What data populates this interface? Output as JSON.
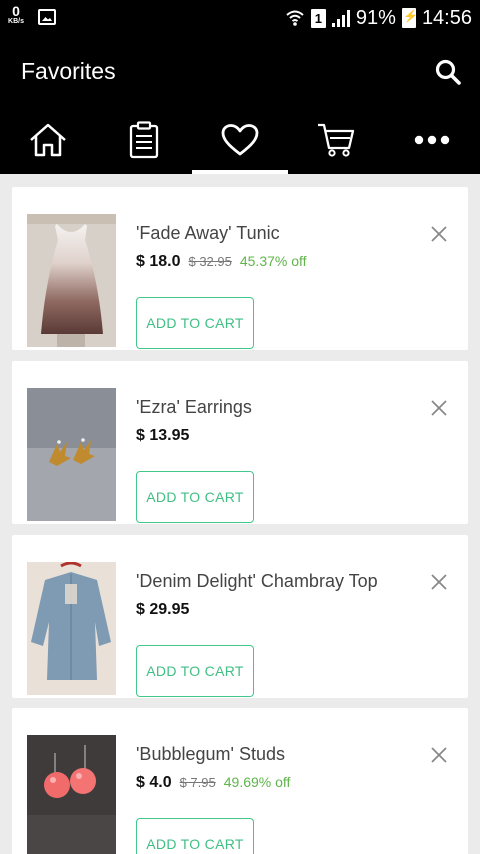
{
  "status_bar": {
    "kbs_value": "0",
    "kbs_unit": "KB/s",
    "sim_slot": "1",
    "battery_text": "91%",
    "time": "14:56",
    "icons": [
      "gallery-icon",
      "wifi-icon",
      "sim-icon",
      "signal-icon",
      "battery-charging-icon"
    ]
  },
  "app_bar": {
    "title": "Favorites",
    "search_icon": "search-icon"
  },
  "tabs": [
    {
      "icon": "home-icon",
      "active": false
    },
    {
      "icon": "clipboard-list-icon",
      "active": false
    },
    {
      "icon": "heart-icon",
      "active": true
    },
    {
      "icon": "cart-icon",
      "active": false
    },
    {
      "icon": "more-icon",
      "active": false
    }
  ],
  "favorites": [
    {
      "name": "'Fade Away' Tunic",
      "price": "$ 18.0",
      "original_price": "$ 32.95",
      "discount": "45.37% off",
      "button": "ADD TO CART",
      "image": "white-to-brown-ombre-tunic"
    },
    {
      "name": "'Ezra' Earrings",
      "price": "$ 13.95",
      "original_price": "",
      "discount": "",
      "button": "ADD TO CART",
      "image": "gold-leaf-earrings"
    },
    {
      "name": "'Denim Delight' Chambray Top",
      "price": "$ 29.95",
      "original_price": "",
      "discount": "",
      "button": "ADD TO CART",
      "image": "chambray-top-on-hanger"
    },
    {
      "name": "'Bubblegum' Studs",
      "price": "$ 4.0",
      "original_price": "$ 7.95",
      "discount": "49.69% off",
      "button": "ADD TO CART",
      "image": "pink-bead-studs"
    }
  ],
  "colors": {
    "bar_background": "#000000",
    "list_background": "#ebebeb",
    "accent_green": "#3fbf83",
    "discount_green": "#5fb54a"
  }
}
